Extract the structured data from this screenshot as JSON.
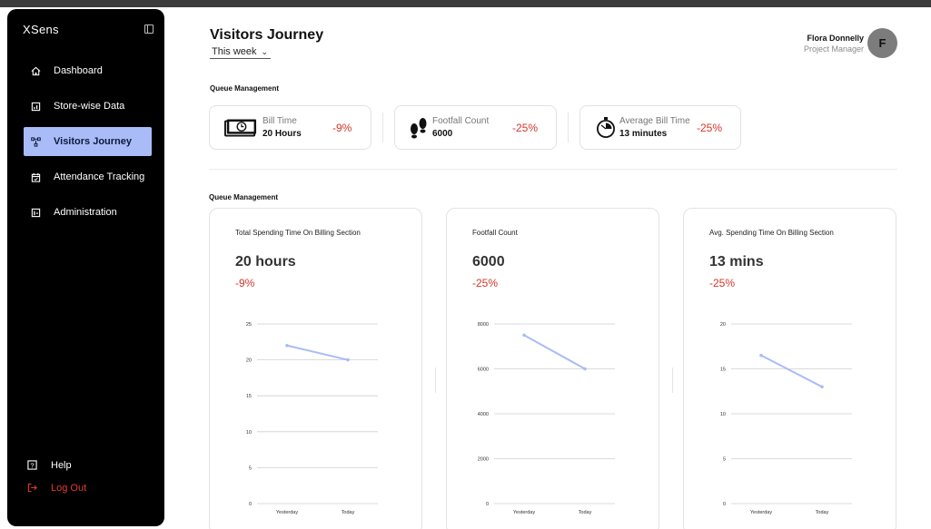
{
  "sidebar": {
    "brand": "XSens",
    "items": [
      {
        "label": "Dashboard",
        "icon": "home-icon",
        "active": false
      },
      {
        "label": "Store-wise Data",
        "icon": "store-data-icon",
        "active": false
      },
      {
        "label": "Visitors Journey",
        "icon": "journey-icon",
        "active": true
      },
      {
        "label": "Attendance Tracking",
        "icon": "calendar-icon",
        "active": false
      },
      {
        "label": "Administration",
        "icon": "admin-icon",
        "active": false
      }
    ],
    "help_label": "Help",
    "logout_label": "Log Out"
  },
  "header": {
    "title": "Visitors Journey",
    "period": "This week",
    "user_name": "Flora Donnelly",
    "user_role": "Project Manager",
    "avatar_initial": "F"
  },
  "section1_label": "Queue Management",
  "section2_label": "Queue Management",
  "kpis": [
    {
      "label": "Bill Time",
      "value": "20 Hours",
      "delta": "-9%",
      "icon": "cash-clock-icon"
    },
    {
      "label": "Footfall Count",
      "value": "6000",
      "delta": "-25%",
      "icon": "footprints-icon"
    },
    {
      "label": "Average Bill Time",
      "value": "13 minutes",
      "delta": "-25%",
      "icon": "stopwatch-icon"
    }
  ],
  "cards": [
    {
      "title": "Total Spending Time On Billing Section",
      "value": "20 hours",
      "delta": "-9%"
    },
    {
      "title": "Footfall Count",
      "value": "6000",
      "delta": "-25%"
    },
    {
      "title": "Avg. Spending Time On Billing Section",
      "value": "13 mins",
      "delta": "-25%"
    }
  ],
  "colors": {
    "accent": "#a9bcf7",
    "negative": "#d4342a",
    "line": "#a9bcf7"
  },
  "chart_data": [
    {
      "type": "line",
      "categories": [
        "Yesterday",
        "Today"
      ],
      "series": [
        {
          "values": [
            22,
            20
          ]
        }
      ],
      "yticks": [
        0,
        5,
        10,
        15,
        20,
        25
      ],
      "ytick_labels": [
        "0",
        "5",
        "10",
        "15",
        "20",
        "25"
      ],
      "ylim": [
        0,
        25
      ]
    },
    {
      "type": "line",
      "categories": [
        "Yesterday",
        "Today"
      ],
      "series": [
        {
          "values": [
            7500,
            6000
          ]
        }
      ],
      "yticks": [
        0,
        2000,
        4000,
        6000,
        8000
      ],
      "ytick_labels": [
        "0",
        "2000",
        "4000",
        "6000",
        "8000"
      ],
      "ylim": [
        0,
        8000
      ]
    },
    {
      "type": "line",
      "categories": [
        "Yesterday",
        "Today"
      ],
      "series": [
        {
          "values": [
            16.5,
            13
          ]
        }
      ],
      "yticks": [
        0,
        5,
        10,
        15,
        20
      ],
      "ytick_labels": [
        "0",
        "5",
        "10",
        "15",
        "20"
      ],
      "ylim": [
        0,
        20
      ]
    }
  ]
}
